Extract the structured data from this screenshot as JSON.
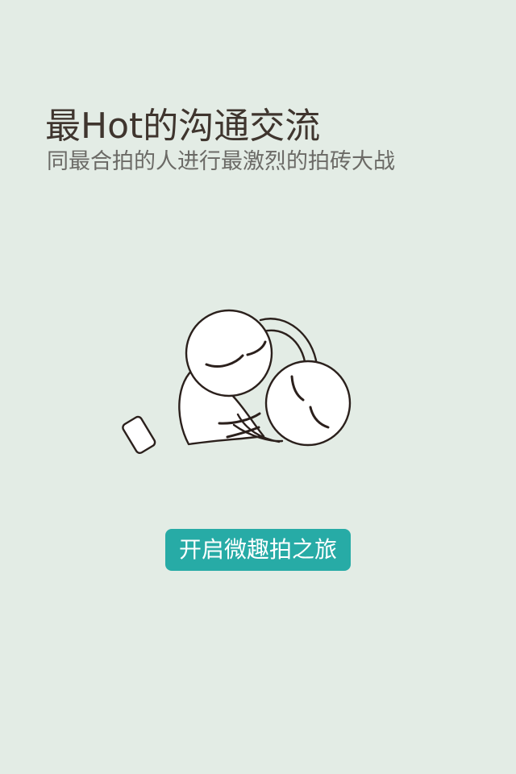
{
  "intro": {
    "headline": "最Hot的沟通交流",
    "subheadline": "同最合拍的人进行最激烈的拍砖大战"
  },
  "actions": {
    "start_label": "开启微趣拍之旅"
  },
  "icons": {
    "illustration": "two-cartoon-characters-with-brick-icon"
  },
  "colors": {
    "background": "#e3ece5",
    "headline": "#3f352e",
    "subheadline": "#6b6a66",
    "button": "#27aba6",
    "button_text": "#ffffff",
    "line_art": "#2b201c"
  }
}
